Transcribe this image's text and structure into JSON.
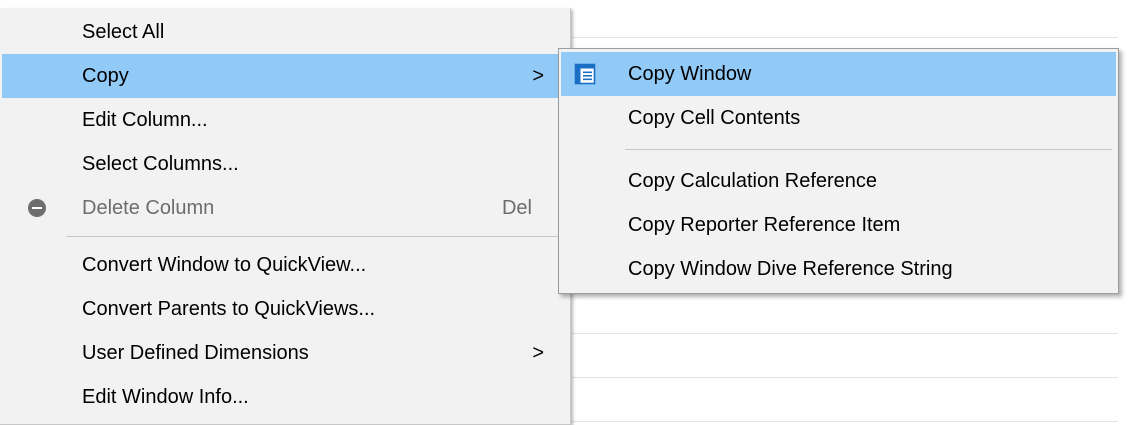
{
  "main_menu": {
    "items": [
      {
        "label": "Select All"
      },
      {
        "label": "Copy",
        "has_submenu": true,
        "highlighted": true
      },
      {
        "label": "Edit Column..."
      },
      {
        "label": "Select Columns..."
      },
      {
        "label": "Delete Column",
        "shortcut": "Del",
        "disabled": true,
        "icon": "delete-circle-icon"
      },
      {
        "label": "Convert Window to QuickView..."
      },
      {
        "label": "Convert Parents to QuickViews..."
      },
      {
        "label": "User Defined Dimensions",
        "has_submenu": true
      },
      {
        "label": "Edit Window Info..."
      }
    ],
    "submenu_arrow": ">"
  },
  "copy_submenu": {
    "items": [
      {
        "label": "Copy Window",
        "highlighted": true,
        "icon": "window-copy-icon"
      },
      {
        "label": "Copy Cell Contents"
      },
      {
        "label": "Copy Calculation Reference"
      },
      {
        "label": "Copy Reporter Reference Item"
      },
      {
        "label": "Copy Window Dive Reference String"
      }
    ]
  },
  "colors": {
    "highlight": "#91c9f7",
    "menu_background": "#f2f2f2",
    "disabled_text": "#6d6d6d",
    "icon_blue": "#1a6fc4"
  }
}
